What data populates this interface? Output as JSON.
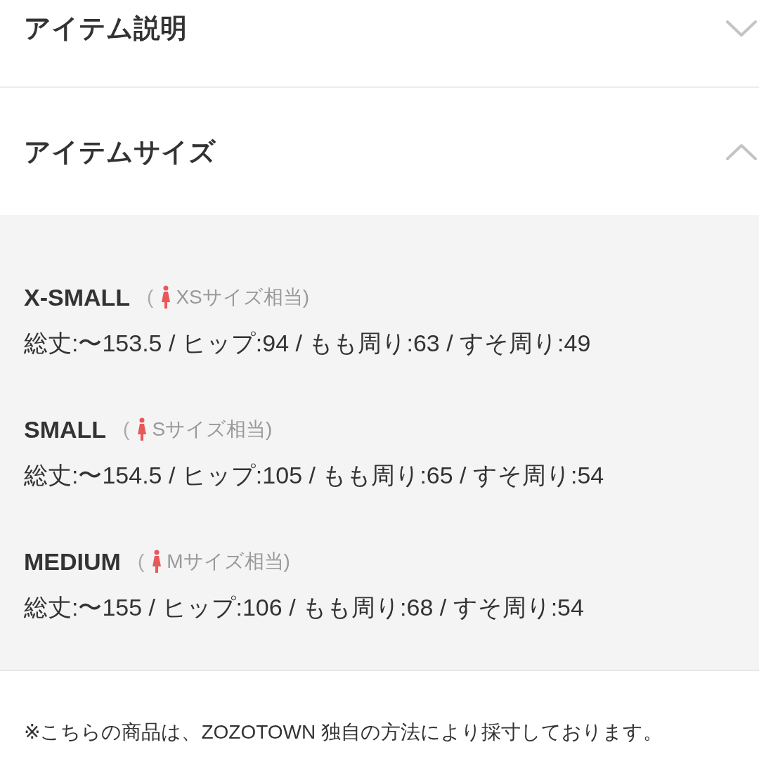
{
  "sections": [
    {
      "title": "アイテム説明",
      "expanded": false
    },
    {
      "title": "アイテムサイズ",
      "expanded": true,
      "sizes": [
        {
          "name": "X-SMALL",
          "open": "(",
          "equivalent": "XSサイズ相当)",
          "measurements": "総丈:〜153.5 / ヒップ:94 / もも周り:63 / すそ周り:49"
        },
        {
          "name": "SMALL",
          "open": "(",
          "equivalent": "Sサイズ相当)",
          "measurements": "総丈:〜154.5 / ヒップ:105 / もも周り:65 / すそ周り:54"
        },
        {
          "name": "MEDIUM",
          "open": "(",
          "equivalent": "Mサイズ相当)",
          "measurements": "総丈:〜155 / ヒップ:106 / もも周り:68 / すそ周り:54"
        }
      ]
    }
  ],
  "note": "※こちらの商品は、ZOZOTOWN 独自の方法により採寸しております。"
}
